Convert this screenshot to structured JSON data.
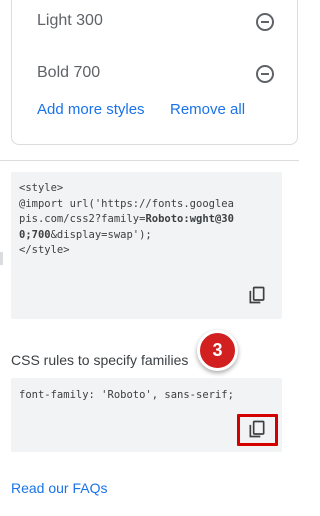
{
  "styles": {
    "items": [
      {
        "label": "Light 300"
      },
      {
        "label": "Bold 700"
      }
    ],
    "add_more_label": "Add more styles",
    "remove_all_label": "Remove all"
  },
  "embed_code": {
    "line1": "<style>",
    "line2": "@import url('https://fonts.googlea",
    "line3_prefix": "pis.com/css2?family=",
    "line3_bold": "Roboto:wght@30",
    "line4_bold": "0;700",
    "line4_suffix": "&display=swap');",
    "line5": "</style>"
  },
  "css_rules": {
    "label": "CSS rules to specify families",
    "code": "font-family: 'Roboto', sans-serif;"
  },
  "annotation": {
    "step": "3",
    "color": "#d21f1f"
  },
  "faq_link": "Read our FAQs",
  "colors": {
    "link": "#1a73e8",
    "code_bg": "#f1f3f4",
    "highlight": "#d40000"
  }
}
